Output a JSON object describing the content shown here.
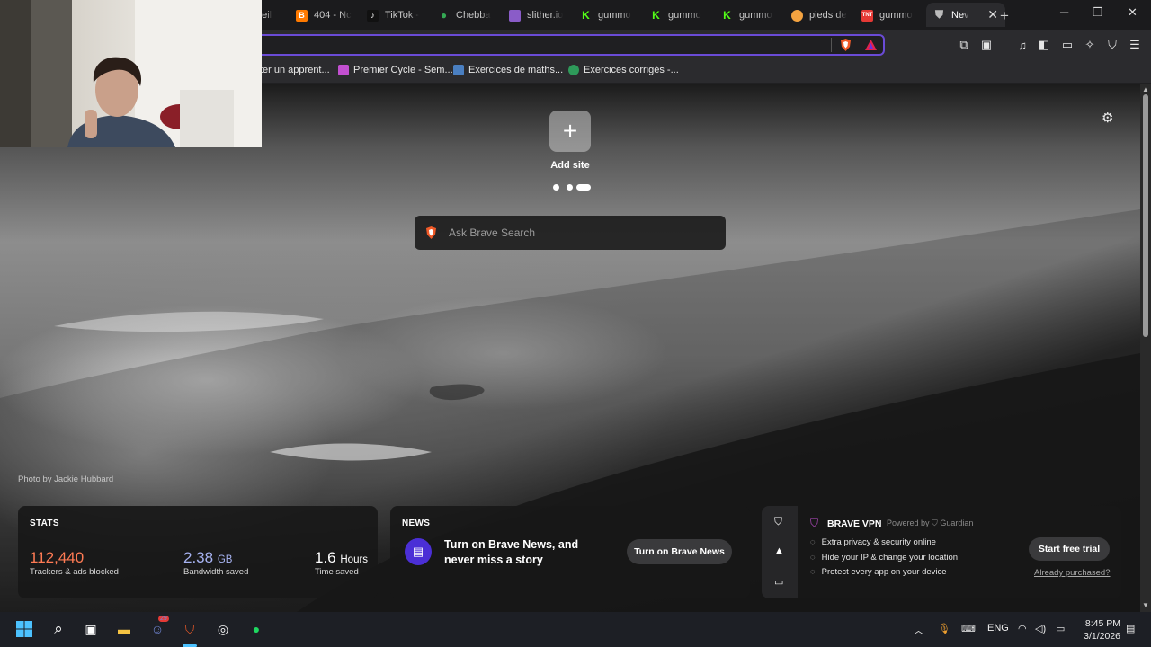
{
  "browser": {
    "tabs": [
      {
        "title": "neil",
        "favicon": "generic-icon",
        "color": "#666666"
      },
      {
        "title": "404 - Nc",
        "favicon": "blogger-icon",
        "color": "#ff7a00"
      },
      {
        "title": "TikTok -",
        "favicon": "tiktok-icon",
        "color": "#111111"
      },
      {
        "title": "Chebba",
        "favicon": "maps-pin-icon",
        "color": "#34a853"
      },
      {
        "title": "slither.io",
        "favicon": "slither-icon",
        "color": "#8a5cc8"
      },
      {
        "title": "gummo",
        "favicon": "kick-icon",
        "color": "#53fc18"
      },
      {
        "title": "gummo",
        "favicon": "kick-icon",
        "color": "#53fc18"
      },
      {
        "title": "gummo",
        "favicon": "kick-icon",
        "color": "#53fc18"
      },
      {
        "title": "pieds de",
        "favicon": "site-icon",
        "color": "#f4a340"
      },
      {
        "title": "gummo",
        "favicon": "tnt-icon",
        "color": "#e53935"
      }
    ],
    "active_tab": {
      "title": "Nev",
      "favicon": "brave-shield-icon"
    },
    "new_tab_symbol": "+",
    "window_controls": {
      "minimize": "─",
      "maximize": "❐",
      "close": "✕"
    },
    "bookmarks": [
      {
        "label": "ter un apprent...",
        "color": "#777777"
      },
      {
        "label": "Premier Cycle - Sem...",
        "color": "#c24fd0"
      },
      {
        "label": "Exercices de maths...",
        "color": "#4a7fc1"
      },
      {
        "label": "Exercices corrigés -...",
        "color": "#2e9a5a"
      }
    ],
    "accent": "#6a4bd6"
  },
  "newtab": {
    "add_site_symbol": "+",
    "add_site_label": "Add site",
    "search_placeholder": "Ask Brave Search",
    "photo_credit": "Photo by Jackie Hubbard",
    "stats": {
      "title": "STATS",
      "trackers_value": "112,440",
      "trackers_label": "Trackers & ads blocked",
      "trackers_color": "#ff7b54",
      "bandwidth_value": "2.38",
      "bandwidth_unit": "GB",
      "bandwidth_label": "Bandwidth saved",
      "bandwidth_color": "#a7b3f2",
      "time_value": "1.6",
      "time_unit": "Hours",
      "time_label": "Time saved"
    },
    "news": {
      "title": "NEWS",
      "text": "Turn on Brave News, and never miss a story",
      "button": "Turn on Brave News"
    },
    "vpn": {
      "title": "BRAVE VPN",
      "powered_by": "Powered by",
      "partner": "Guardian",
      "features": [
        "Extra privacy & security online",
        "Hide your IP & change your location",
        "Protect every app on your device"
      ],
      "cta": "Start free trial",
      "already": "Already purchased?"
    }
  },
  "taskbar": {
    "discord_badge": "29",
    "language": "ENG",
    "time": "8:45 PM",
    "date": "3/1/2026"
  }
}
